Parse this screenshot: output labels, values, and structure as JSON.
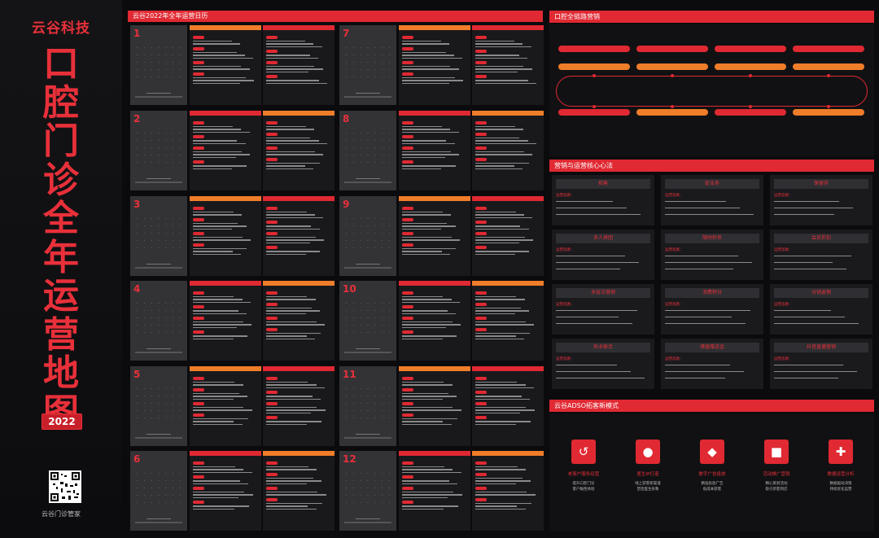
{
  "brand": {
    "name": "云谷科技",
    "title_chars": [
      "口",
      "腔",
      "门",
      "诊",
      "全",
      "年",
      "运",
      "营",
      "地",
      "图"
    ],
    "year": "2022",
    "qr_caption": "云谷门诊管家"
  },
  "calendar": {
    "header": "云谷2022年全年运营日历",
    "months_left": [
      "1",
      "2",
      "3",
      "4",
      "5",
      "6"
    ],
    "months_right": [
      "7",
      "8",
      "9",
      "10",
      "11",
      "12"
    ]
  },
  "sections": {
    "flow_title": "口腔全链路营销",
    "ops_title": "营销与运营核心心法",
    "mode_title": "云谷ADSO拓客新模式"
  },
  "ops_cards": [
    {
      "title": "拓客",
      "sub": "运营思路："
    },
    {
      "title": "促业务",
      "sub": "运营思路："
    },
    {
      "title": "保留存",
      "sub": "运营思路："
    },
    {
      "title": "多人拼团",
      "sub": "运营思路："
    },
    {
      "title": "限时秒杀",
      "sub": "运营思路："
    },
    {
      "title": "会员折扣",
      "sub": "运营思路："
    },
    {
      "title": "多层次营销",
      "sub": "运营思路："
    },
    {
      "title": "消费积分",
      "sub": "运营思路："
    },
    {
      "title": "分销返佣",
      "sub": "运营思路："
    },
    {
      "title": "异业联合",
      "sub": "运营思路："
    },
    {
      "title": "储值赠送金",
      "sub": "运营思路："
    },
    {
      "title": "抖音直播营销",
      "sub": "运营思路："
    }
  ],
  "modes": [
    {
      "label": "老客户服务经营",
      "desc1": "提升口腔门诊",
      "desc2": "客户黏性体验",
      "icon": "↺"
    },
    {
      "label": "医生IP打造",
      "desc1": "线上获客新渠道",
      "desc2": "塑造医生形象",
      "icon": "●"
    },
    {
      "label": "数字广告投放",
      "desc1": "精准投放广告",
      "desc2": "低成本获客",
      "icon": "◆"
    },
    {
      "label": "活动推广营销",
      "desc1": "精心策划活动",
      "desc2": "吸引新客到店",
      "icon": "■"
    },
    {
      "label": "数据运营分析",
      "desc1": "数据驱动决策",
      "desc2": "持续优化运营",
      "icon": "✚"
    }
  ],
  "colors": {
    "accent": "#e02932",
    "secondary": "#ef7d2a",
    "background": "#0b0b0d"
  }
}
